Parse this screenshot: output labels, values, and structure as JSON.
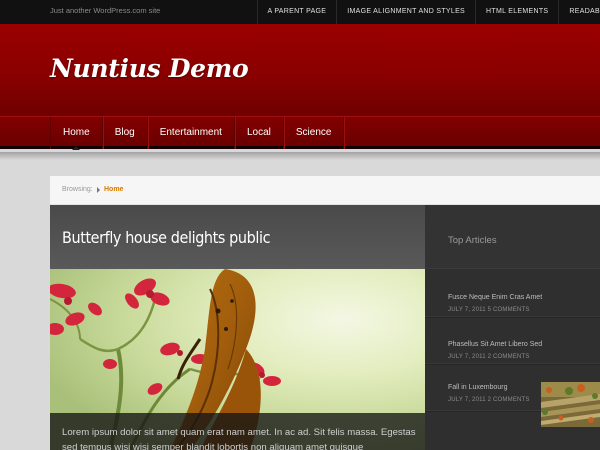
{
  "site": {
    "tagline": "Just another WordPress.com site",
    "title": "Nuntius Demo"
  },
  "top_menu": [
    {
      "label": "A PARENT PAGE"
    },
    {
      "label": "IMAGE ALIGNMENT AND STYLES"
    },
    {
      "label": "HTML ELEMENTS"
    },
    {
      "label": "READAB"
    }
  ],
  "nav": [
    {
      "label": "Home"
    },
    {
      "label": "Blog"
    },
    {
      "label": "Entertainment"
    },
    {
      "label": "Local"
    },
    {
      "label": "Science"
    }
  ],
  "breadcrumb": {
    "label": "Browsing:",
    "current": "Home"
  },
  "feature": {
    "title": "Butterfly house delights public",
    "excerpt": "Lorem ipsum dolor sit amet quam erat nam amet. In ac ad. Sit felis massa. Egestas sed tempus wisi wisi semper blandit lobortis non aliquam amet quisque"
  },
  "sidebar": {
    "title": "Top Articles",
    "articles": [
      {
        "title": "Fusce Neque Enim Cras Amet",
        "meta": "JULY 7, 2011 5 COMMENTS"
      },
      {
        "title": "Phasellus Sit Amet Libero Sed",
        "meta": "JULY 7, 2011 2 COMMENTS"
      },
      {
        "title": "Fall in Luxembourg",
        "meta": "JULY 7, 2011 2 COMMENTS"
      }
    ]
  },
  "colors": {
    "header_red": "#8a0000",
    "accent_orange": "#d97a00",
    "sidebar_bg": "#2f2f2f"
  }
}
